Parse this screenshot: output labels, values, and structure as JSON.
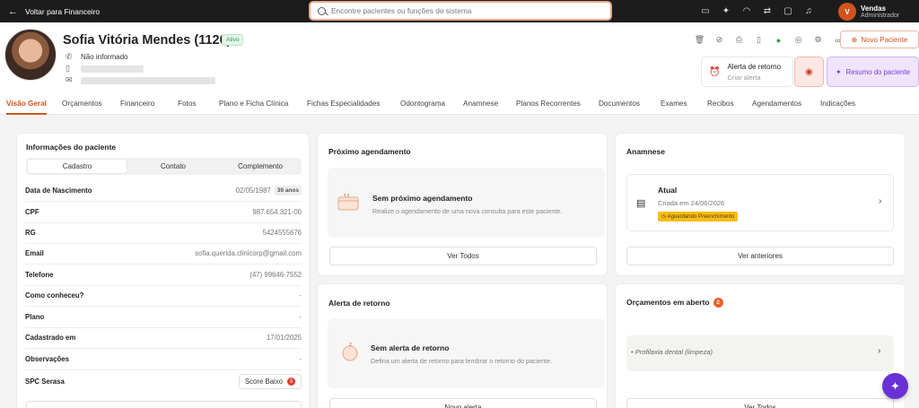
{
  "topbar": {
    "back_label": "Voltar para Financeiro",
    "search_placeholder": "Encontre pacientes ou funções do sistema",
    "icons": [
      "video-icon",
      "sparkle-icon",
      "headset-icon",
      "message-icon",
      "chat-icon",
      "bell-icon"
    ],
    "user": {
      "initial": "V",
      "name": "Vendas",
      "role": "Administrador"
    }
  },
  "patient": {
    "name": "Sofia Vitória Mendes (1120)",
    "status": "Ativo",
    "phone": "Não informado",
    "new_patient_label": "Novo Paciente",
    "return_alert_title": "Alerta de retorno",
    "return_alert_action": "Criar alerta",
    "summary_label": "Resumo do paciente"
  },
  "tabs": [
    "Visão Geral",
    "Orçamentos",
    "Financeiro",
    "Fotos",
    "Plano e Ficha Clínica",
    "Fichas Especialidades",
    "Odontograma",
    "Anamnese",
    "Planos Recorrentes",
    "Documentos",
    "Exames",
    "Recibos",
    "Agendamentos",
    "Indicações"
  ],
  "info": {
    "title": "Informações do paciente",
    "segments": [
      "Cadastro",
      "Contato",
      "Complemento"
    ],
    "rows": [
      {
        "label": "Data de Nascimento",
        "value": "02/05/1987",
        "extra": "39 anos"
      },
      {
        "label": "CPF",
        "value": "987.654.321-00"
      },
      {
        "label": "RG",
        "value": "5424555676"
      },
      {
        "label": "Email",
        "value": "sofia.querida.clinicorp@gmail.com"
      },
      {
        "label": "Telefone",
        "value": "(47) 99646-7552"
      },
      {
        "label": "Como conheceu?",
        "value": "-"
      },
      {
        "label": "Plano",
        "value": "-"
      },
      {
        "label": "Cadastrado em",
        "value": "17/01/2025"
      },
      {
        "label": "Observações",
        "value": "-"
      }
    ],
    "spc_label": "SPC Serasa",
    "score_label": "Score Baixo",
    "score_badge": "5"
  },
  "agenda": {
    "title": "Próximo agendamento",
    "empty_title": "Sem próximo agendamento",
    "empty_desc": "Realize o agendamento de uma nova consulta para este paciente.",
    "button": "Ver Todos"
  },
  "alerta": {
    "title": "Alerta de retorno",
    "empty_title": "Sem alerta de retorno",
    "empty_desc": "Defina um alerta de retorno para lembrar o retorno do paciente.",
    "button": "Novo alerta"
  },
  "anamnese": {
    "title": "Anamnese",
    "item_title": "Atual",
    "item_date": "Criada em 24/06/2026",
    "item_badge": "Aguardando Preenchimento",
    "button": "Ver anteriores"
  },
  "orcamentos": {
    "title": "Orçamentos em aberto",
    "count": "2",
    "item": "Profilaxia dental (limpeza)",
    "button": "Ver Todos"
  },
  "colors": {
    "accent": "#d2531e",
    "purple": "#7b3ccf",
    "dark": "#1c1c1c"
  }
}
